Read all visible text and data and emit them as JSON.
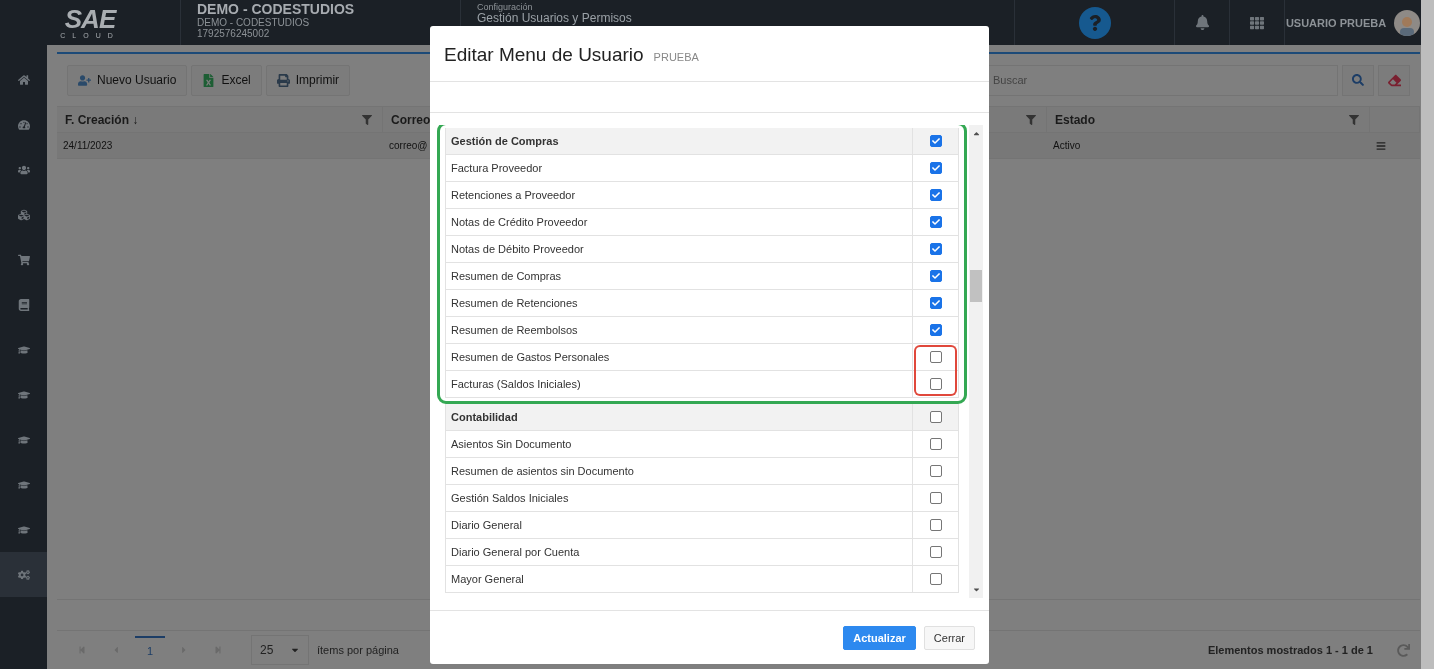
{
  "logo": {
    "mark": "SAE",
    "sub": "CLOUD"
  },
  "company": {
    "name": "DEMO - CODESTUDIOS",
    "branch": "DEMO - CODESTUDIOS",
    "ruc": "1792576245002"
  },
  "breadcrumb": {
    "section": "Configuración",
    "page": "Gestión Usuarios y Permisos"
  },
  "user": {
    "name": "USUARIO PRUEBA"
  },
  "sidebar": {
    "items": [
      {
        "selected": false
      },
      {
        "selected": false
      },
      {
        "selected": false
      },
      {
        "selected": false
      },
      {
        "selected": false
      },
      {
        "selected": false
      },
      {
        "selected": false
      },
      {
        "selected": false
      },
      {
        "selected": false
      },
      {
        "selected": false
      },
      {
        "selected": false
      },
      {
        "selected": true
      }
    ]
  },
  "toolbar": {
    "buttons": [
      {
        "label": "Nuevo Usuario"
      },
      {
        "label": "Excel"
      },
      {
        "label": "Imprimir"
      }
    ],
    "search": {
      "placeholder": "Buscar"
    }
  },
  "table": {
    "columns": [
      "F. Creación ↓",
      "Correo",
      "Estado"
    ],
    "rows": [
      {
        "cells": [
          "24/11/2023",
          "correo@",
          "Activo"
        ]
      }
    ]
  },
  "pager": {
    "page": "1",
    "page_size": "25",
    "page_size_label": "ítems por página",
    "summary": "Elementos mostrados 1 - 1 de 1"
  },
  "dialog": {
    "title": "Editar Menu de Usuario",
    "subtitle": "PRUEBA",
    "sections": [
      {
        "title": "Gestión de Compras",
        "checked": true,
        "outlined": true,
        "items": [
          {
            "label": "Factura Proveedor",
            "checked": true,
            "flagged": false
          },
          {
            "label": "Retenciones a Proveedor",
            "checked": true,
            "flagged": false
          },
          {
            "label": "Notas de Crédito Proveedor",
            "checked": true,
            "flagged": false
          },
          {
            "label": "Notas de Débito Proveedor",
            "checked": true,
            "flagged": false
          },
          {
            "label": "Resumen de Compras",
            "checked": true,
            "flagged": false
          },
          {
            "label": "Resumen de Retenciones",
            "checked": true,
            "flagged": false
          },
          {
            "label": "Resumen de Reembolsos",
            "checked": true,
            "flagged": false
          },
          {
            "label": "Resumen de Gastos Personales",
            "checked": false,
            "flagged": true
          },
          {
            "label": "Facturas (Saldos Iniciales)",
            "checked": false,
            "flagged": true
          }
        ]
      },
      {
        "title": "Contabilidad",
        "checked": false,
        "outlined": false,
        "items": [
          {
            "label": "Asientos Sin Documento",
            "checked": false,
            "flagged": false
          },
          {
            "label": "Resumen de asientos sin Documento",
            "checked": false,
            "flagged": false
          },
          {
            "label": "Gestión Saldos Iniciales",
            "checked": false,
            "flagged": false
          },
          {
            "label": "Diario General",
            "checked": false,
            "flagged": false
          },
          {
            "label": "Diario General por Cuenta",
            "checked": false,
            "flagged": false
          },
          {
            "label": "Mayor General",
            "checked": false,
            "flagged": false
          }
        ]
      }
    ],
    "buttons": [
      {
        "kind": "primary",
        "label": "Actualizar"
      },
      {
        "kind": "secondary",
        "label": "Cerrar"
      }
    ]
  }
}
